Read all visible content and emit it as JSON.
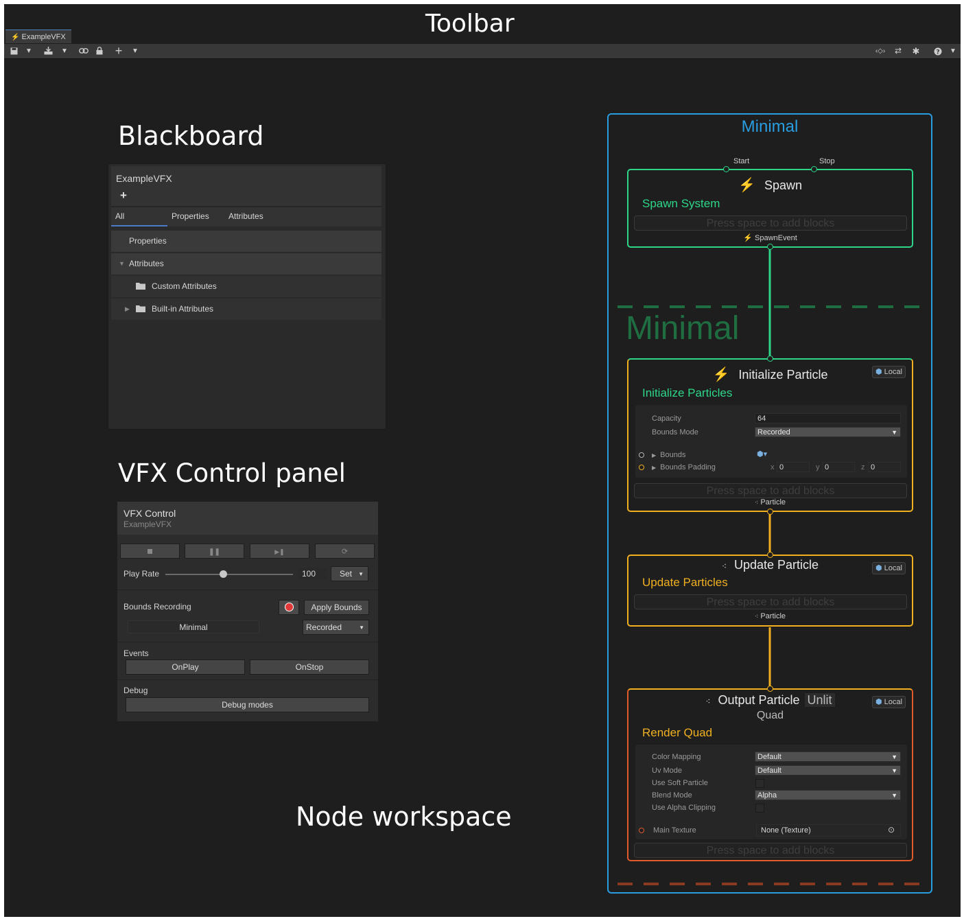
{
  "annotations": {
    "toolbar": "Toolbar",
    "blackboard": "Blackboard",
    "control_panel": "VFX Control panel",
    "workspace": "Node workspace"
  },
  "toolbar": {
    "tab_title": "ExampleVFX",
    "icons_left": [
      "save-icon",
      "dropdown-icon",
      "save-as-icon",
      "dropdown-icon",
      "link-icon",
      "lock-icon",
      "add-icon",
      "dropdown-icon"
    ],
    "icons_right": [
      "code-icon",
      "compare-icon",
      "debug-bug-icon",
      "help-icon",
      "dropdown-icon"
    ]
  },
  "blackboard": {
    "title": "ExampleVFX",
    "add_label": "+",
    "tabs": [
      "All",
      "Properties",
      "Attributes"
    ],
    "rows": {
      "properties": "Properties",
      "attributes": "Attributes",
      "custom": "Custom Attributes",
      "builtin": "Built-in Attributes"
    }
  },
  "vfx_control": {
    "title": "VFX Control",
    "subtitle": "ExampleVFX",
    "transport": [
      "stop-icon",
      "pause-icon",
      "step-icon",
      "restart-icon"
    ],
    "play_rate_label": "Play Rate",
    "play_rate_value": "100",
    "play_rate_slider_fraction": 0.45,
    "set_label": "Set",
    "bounds_recording_label": "Bounds Recording",
    "apply_bounds_label": "Apply Bounds",
    "system_name": "Minimal",
    "bounds_mode": "Recorded",
    "events_label": "Events",
    "on_play_label": "OnPlay",
    "on_stop_label": "OnStop",
    "debug_label": "Debug",
    "debug_modes_label": "Debug modes"
  },
  "graph": {
    "system_title": "Minimal",
    "group_title": "Minimal",
    "colors": {
      "system": "#2a9de0",
      "spawn": "#2ed68a",
      "update": "#f0b020",
      "output": "#e05a2a",
      "group_dash_top": "#1f6e42"
    },
    "spawn": {
      "start_label": "Start",
      "stop_label": "Stop",
      "title": "Spawn",
      "context": "Spawn System",
      "press_hint": "Press space to add blocks",
      "out_label": "SpawnEvent"
    },
    "initialize": {
      "title": "Initialize Particle",
      "space": "Local",
      "context": "Initialize Particles",
      "capacity_label": "Capacity",
      "capacity_value": "64",
      "bounds_mode_label": "Bounds Mode",
      "bounds_mode_value": "Recorded",
      "bounds_label": "Bounds",
      "bounds_padding_label": "Bounds Padding",
      "x_label": "x",
      "x_value": "0",
      "y_label": "y",
      "y_value": "0",
      "z_label": "z",
      "z_value": "0",
      "press_hint": "Press space to add blocks",
      "out_label": "Particle"
    },
    "update": {
      "title": "Update Particle",
      "space": "Local",
      "context": "Update Particles",
      "press_hint": "Press space to add blocks",
      "out_label": "Particle"
    },
    "output": {
      "title": "Output Particle",
      "mode": "Unlit",
      "subtitle": "Quad",
      "space": "Local",
      "context": "Render Quad",
      "color_mapping_label": "Color Mapping",
      "color_mapping_value": "Default",
      "uv_mode_label": "Uv Mode",
      "uv_mode_value": "Default",
      "soft_particle_label": "Use Soft Particle",
      "blend_mode_label": "Blend Mode",
      "blend_mode_value": "Alpha",
      "alpha_clip_label": "Use Alpha Clipping",
      "main_texture_label": "Main Texture",
      "main_texture_value": "None (Texture)",
      "press_hint": "Press space to add blocks"
    }
  }
}
